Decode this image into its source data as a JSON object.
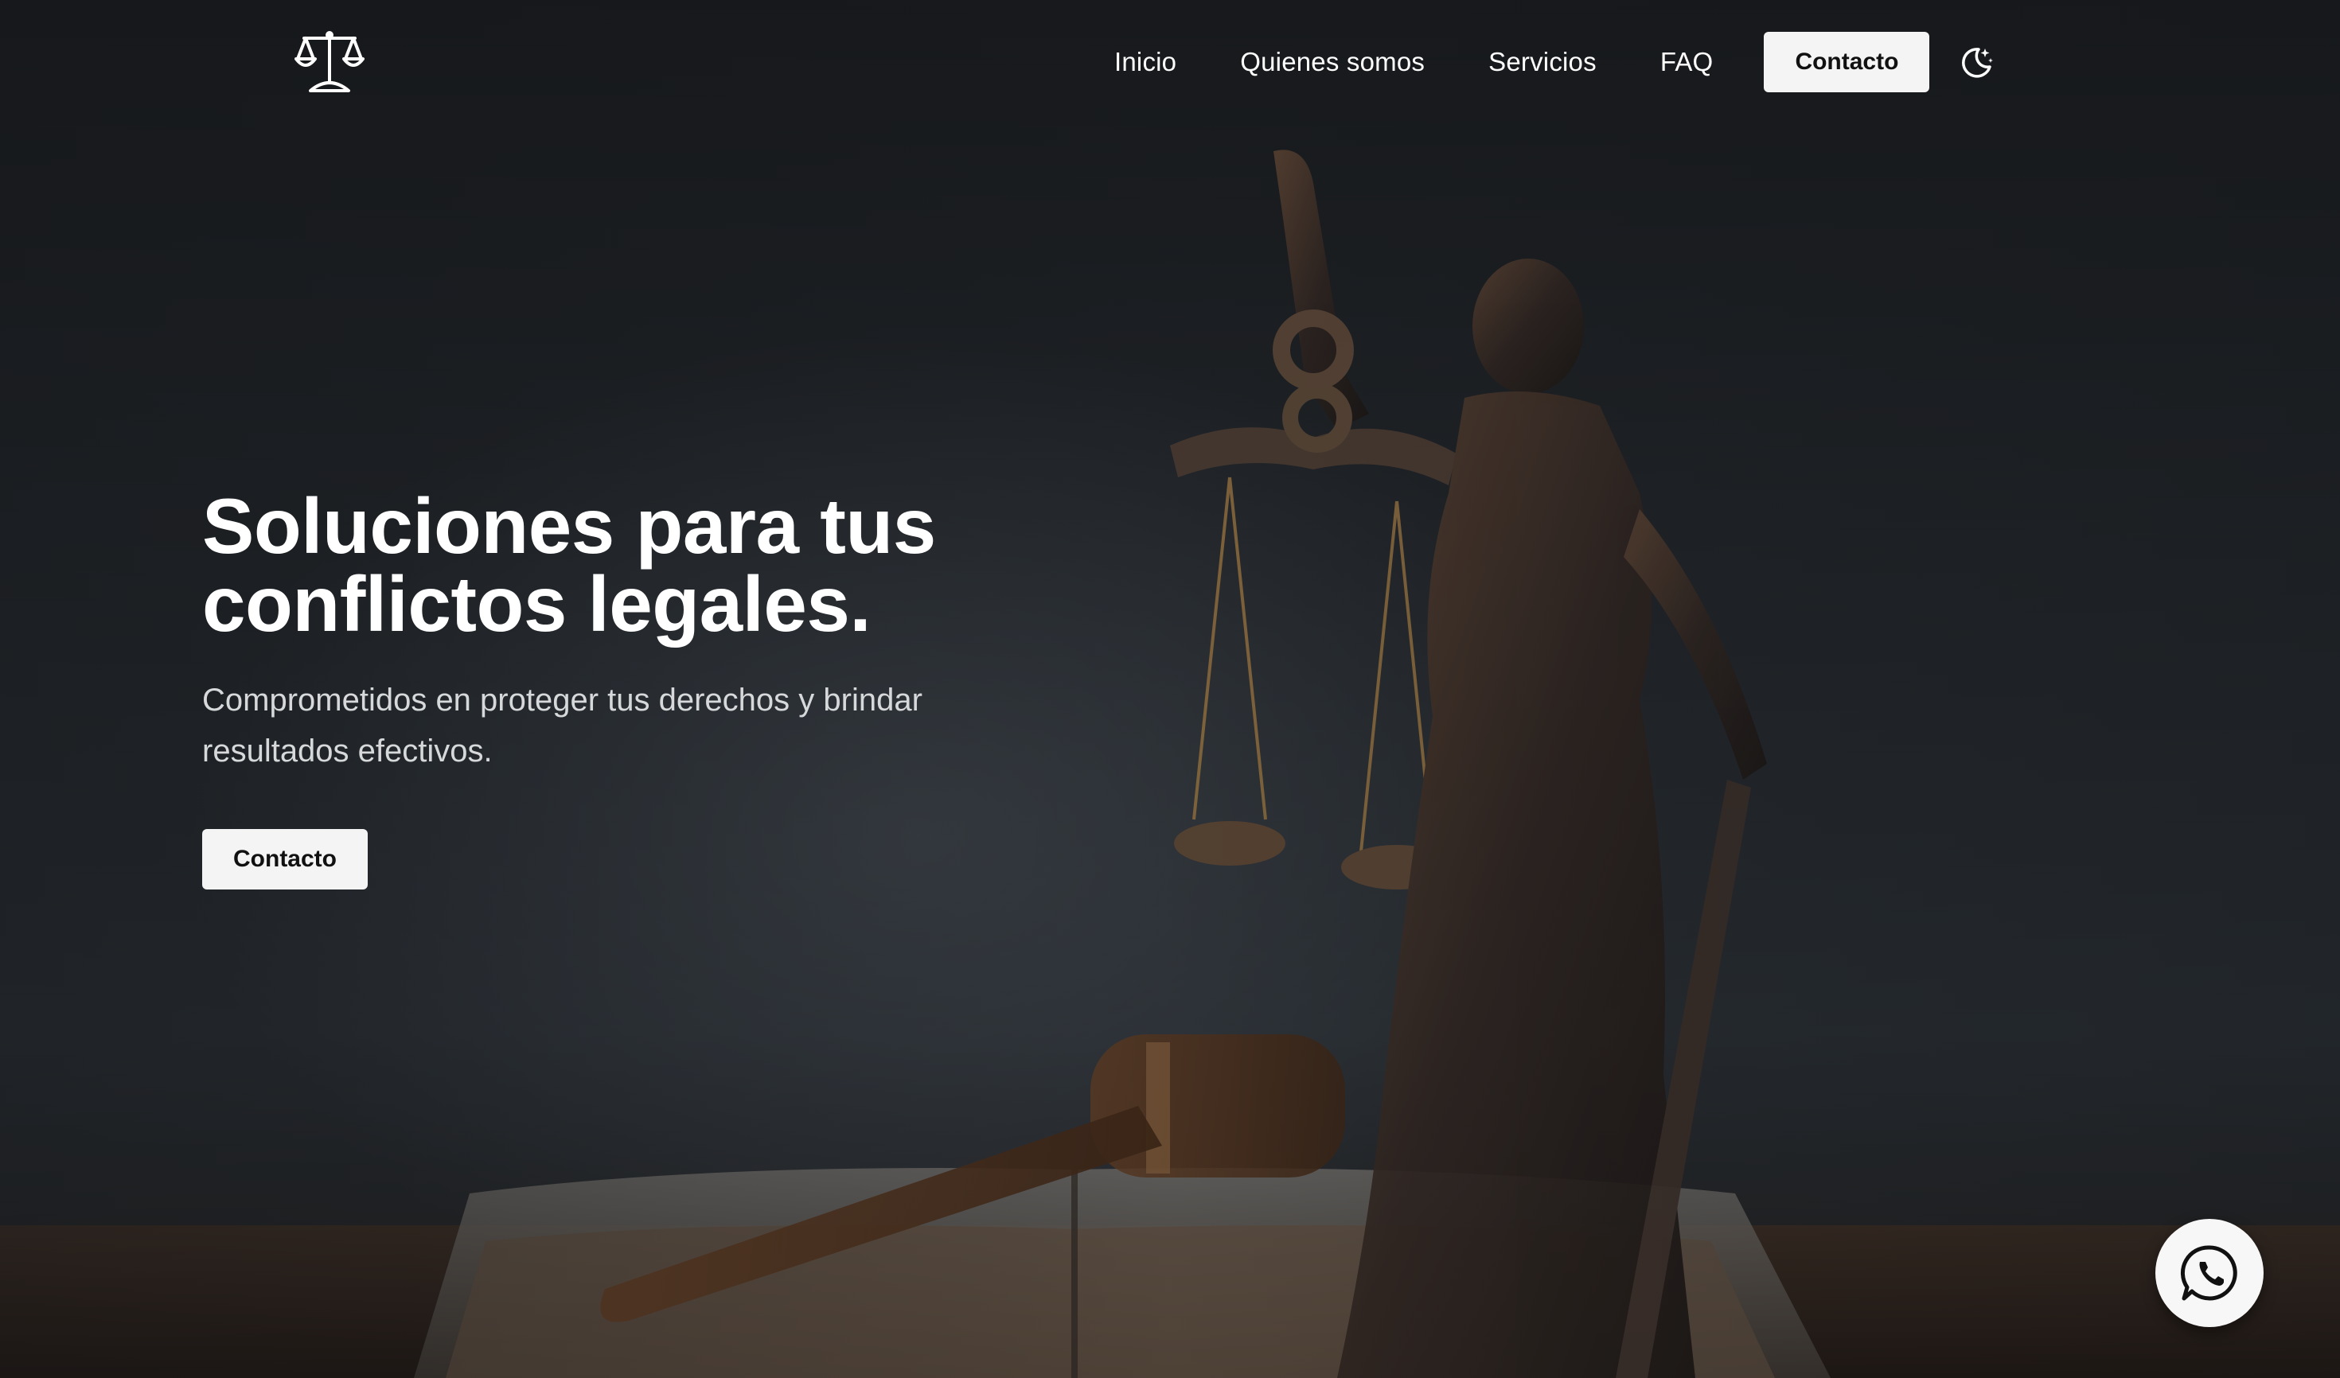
{
  "brand": {
    "logo_icon": "scales-of-justice-icon"
  },
  "nav": {
    "items": [
      {
        "label": "Inicio"
      },
      {
        "label": "Quienes somos"
      },
      {
        "label": "Servicios"
      },
      {
        "label": "FAQ"
      }
    ],
    "cta_label": "Contacto",
    "theme_toggle_icon": "moon-stars-icon"
  },
  "hero": {
    "title_line1": "Soluciones para tus",
    "title_line2": "conflictos legales.",
    "subtitle": "Comprometidos en proteger tus derechos y brindar resultados efectivos.",
    "cta_label": "Contacto",
    "background_image": "lady-justice-statue-gavel-book"
  },
  "floating": {
    "whatsapp_icon": "whatsapp-icon"
  },
  "colors": {
    "background": "#1c1f22",
    "text": "#ffffff",
    "subtext": "#d6d8da",
    "button_bg": "#f4f4f4",
    "button_text": "#111111"
  }
}
